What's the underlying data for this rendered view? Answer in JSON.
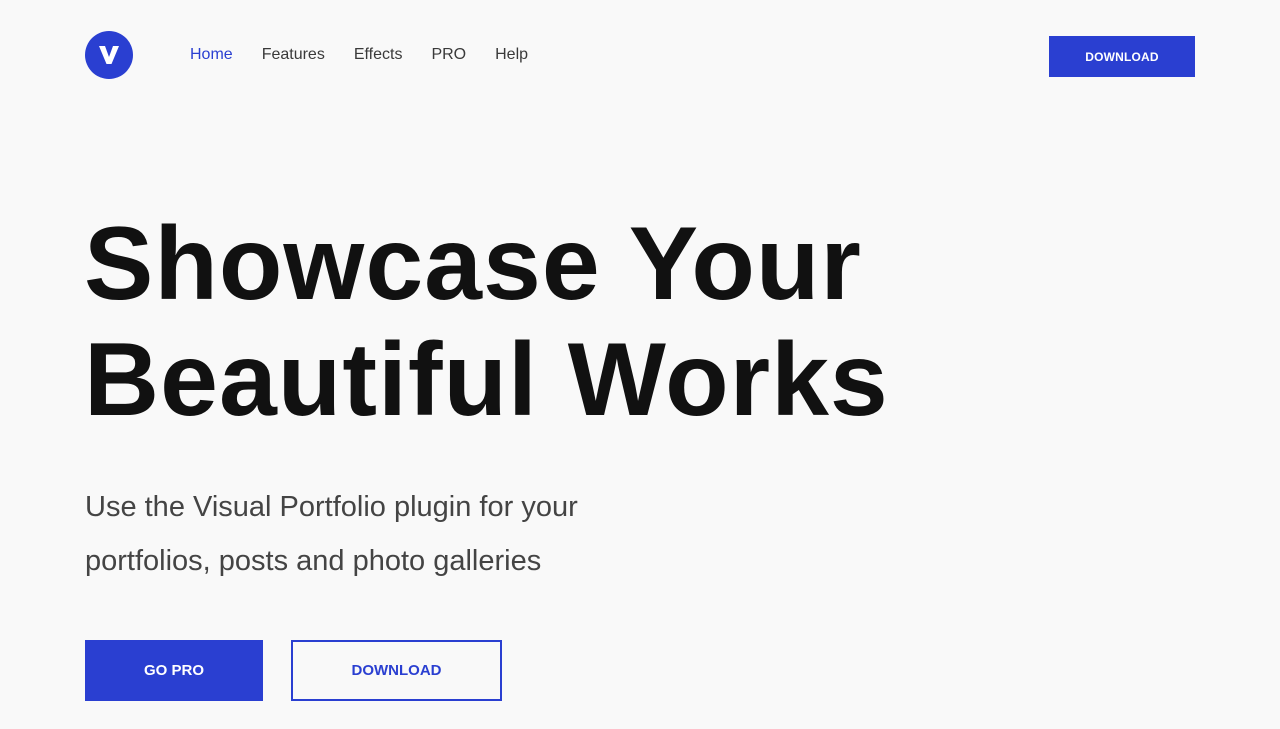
{
  "header": {
    "logo": {
      "icon": "v-logo-icon",
      "letter": "V",
      "color": "#2a3fd1"
    },
    "nav": [
      {
        "label": "Home",
        "active": true
      },
      {
        "label": "Features",
        "active": false
      },
      {
        "label": "Effects",
        "active": false
      },
      {
        "label": "PRO",
        "active": false
      },
      {
        "label": "Help",
        "active": false
      }
    ],
    "download_label": "DOWNLOAD"
  },
  "hero": {
    "title_line1": "Showcase Your",
    "title_line2": "Beautiful Works",
    "subtitle_line1": "Use the Visual Portfolio plugin for your",
    "subtitle_line2": "portfolios, posts and photo galleries",
    "primary_button": "GO PRO",
    "secondary_button": "DOWNLOAD"
  },
  "colors": {
    "accent": "#2a3fd1",
    "background": "#f9f9f9",
    "text": "#111111"
  }
}
